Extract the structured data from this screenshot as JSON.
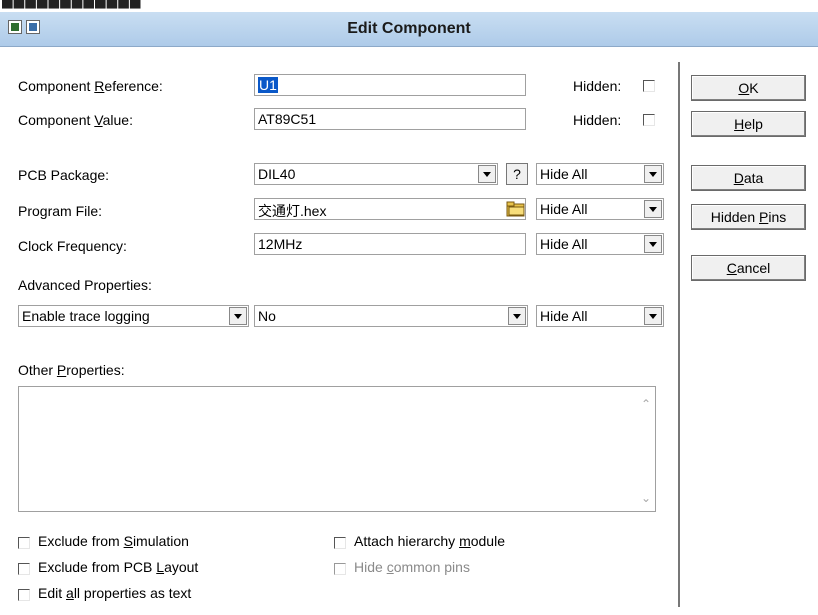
{
  "window": {
    "title": "Edit Component",
    "top_strip_text": "████████████"
  },
  "fields": {
    "component_reference": {
      "label_pre": "Component ",
      "label_u": "R",
      "label_post": "eference:",
      "value": "U1",
      "hidden_label": "Hidden:"
    },
    "component_value": {
      "label_pre": "Component ",
      "label_u": "V",
      "label_post": "alue:",
      "value": "AT89C51",
      "hidden_label": "Hidden:"
    },
    "pcb_package": {
      "label": "PCB Package:",
      "value": "DIL40",
      "query_label": "?",
      "visibility": "Hide All"
    },
    "program_file": {
      "label": "Program File:",
      "value": "交通灯.hex",
      "visibility": "Hide All"
    },
    "clock_frequency": {
      "label": "Clock Frequency:",
      "value": "12MHz",
      "visibility": "Hide All"
    },
    "advanced_properties": {
      "label": "Advanced Properties:",
      "property": "Enable trace logging",
      "value": "No",
      "visibility": "Hide All"
    },
    "other_properties": {
      "label_pre": "Other ",
      "label_u": "P",
      "label_post": "roperties:",
      "text": ""
    }
  },
  "checkboxes": {
    "exclude_simulation": {
      "pre": "Exclude from ",
      "u": "S",
      "post": "imulation"
    },
    "exclude_pcb": {
      "pre": "Exclude from PCB ",
      "u": "L",
      "post": "ayout"
    },
    "edit_all": {
      "pre": "Edit ",
      "u": "a",
      "post": "ll properties as text"
    },
    "attach_hierarchy": {
      "pre": "Attach hierarchy ",
      "u": "m",
      "post": "odule"
    },
    "hide_common_pins": {
      "pre": "Hide ",
      "u": "c",
      "post": "ommon pins"
    }
  },
  "buttons": {
    "ok": {
      "u": "O",
      "post": "K"
    },
    "help": {
      "u": "H",
      "post": "elp"
    },
    "data": {
      "u": "D",
      "post": "ata"
    },
    "hidden_pins": {
      "pre": "Hidden ",
      "u": "P",
      "post": "ins"
    },
    "cancel": {
      "u": "C",
      "post": "ancel"
    }
  },
  "colors": {
    "titlebar": "#aecbe9",
    "selection": "#0a58c8"
  }
}
